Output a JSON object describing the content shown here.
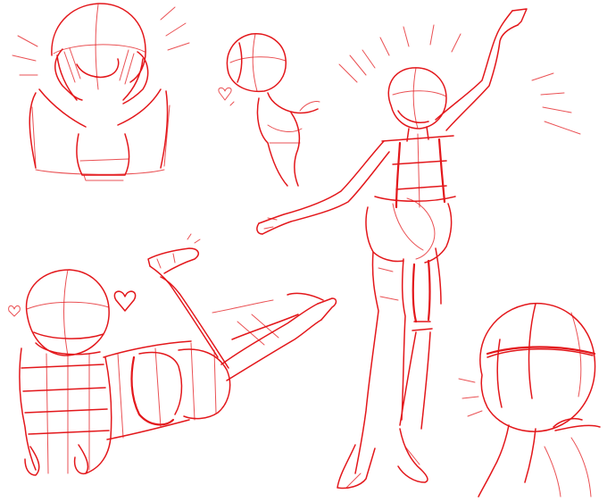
{
  "sketch": {
    "ink_color": "#e3171b",
    "background": "#ffffff",
    "figures": [
      {
        "name": "figure-cheeks-in-hands"
      },
      {
        "name": "figure-chibi-heart"
      },
      {
        "name": "figure-standing-arm-raised"
      },
      {
        "name": "figure-lying-prone-legs-up"
      },
      {
        "name": "figure-head-closeup"
      }
    ]
  }
}
